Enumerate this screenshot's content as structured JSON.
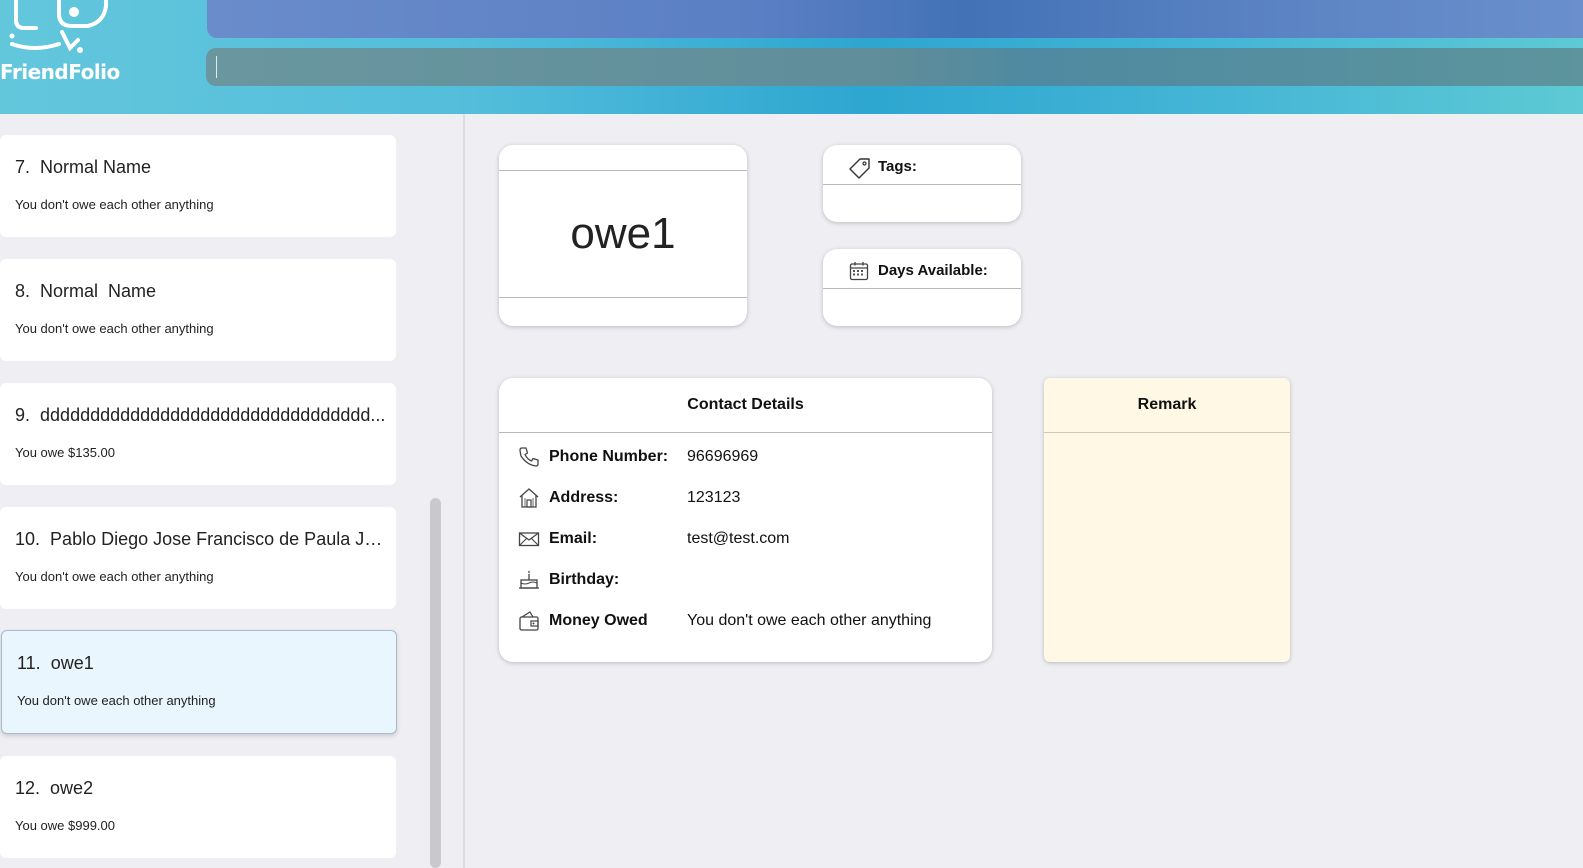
{
  "app": {
    "logo_text": "FriendFolio"
  },
  "command": {
    "value": ""
  },
  "list": {
    "items": [
      {
        "index": "7.",
        "name": "Normal Name",
        "status": "You don't owe each other anything"
      },
      {
        "index": "8.",
        "name": "Normal  Name",
        "status": "You don't owe each other anything"
      },
      {
        "index": "9.",
        "name": "ddddddddddddddddddddddddddddddddd...",
        "status": "You owe $135.00"
      },
      {
        "index": "10.",
        "name": "Pablo Diego Jose Francisco de Paula Juan...",
        "status": "You don't owe each other anything"
      },
      {
        "index": "11.",
        "name": "owe1",
        "status": "You don't owe each other anything"
      },
      {
        "index": "12.",
        "name": "owe2",
        "status": "You owe $999.00"
      }
    ]
  },
  "detail": {
    "name": "owe1",
    "tags_label": "Tags:",
    "days_label": "Days Available:",
    "contact_title": "Contact Details",
    "phone_label": "Phone Number:",
    "phone_value": "96696969",
    "address_label": "Address:",
    "address_value": "123123",
    "email_label": "Email:",
    "email_value": "test@test.com",
    "birthday_label": "Birthday:",
    "birthday_value": "",
    "money_label": "Money Owed",
    "money_value": "You don't owe each other anything",
    "remark_title": "Remark"
  },
  "icons": [
    "logo-icon",
    "tag-icon",
    "calendar-icon",
    "phone-icon",
    "house-icon",
    "mail-icon",
    "cake-icon",
    "wallet-icon"
  ],
  "colors": {
    "selected_card": "#eaf6fd",
    "remark_bg": "#fef8e5",
    "header_teal": "#2da6d0"
  }
}
